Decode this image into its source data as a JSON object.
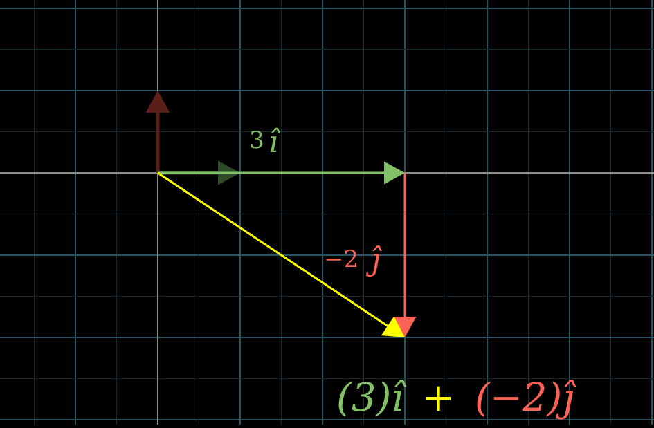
{
  "colors": {
    "background": "#000000",
    "grid_major": "#29535f",
    "grid_minor": "#142a30",
    "axis": "#8c8c8c",
    "i_hat": "#83c167",
    "j_hat": "#fc6255",
    "result": "#ffff00",
    "i_hat_faded": "#2e4a26",
    "j_hat_faded": "#5b1f19"
  },
  "labels": {
    "i_coef": "3",
    "i_symbol": "î",
    "j_coef": "−2",
    "j_symbol": "ĵ",
    "expression": {
      "i_part": "(3)î",
      "plus": "+",
      "j_part": "(−2)ĵ"
    }
  },
  "vectors": {
    "i_hat": [
      1,
      0
    ],
    "j_hat": [
      0,
      1
    ],
    "scaled_i": [
      3,
      0
    ],
    "scaled_j": [
      0,
      -2
    ],
    "result": [
      3,
      -2
    ]
  }
}
